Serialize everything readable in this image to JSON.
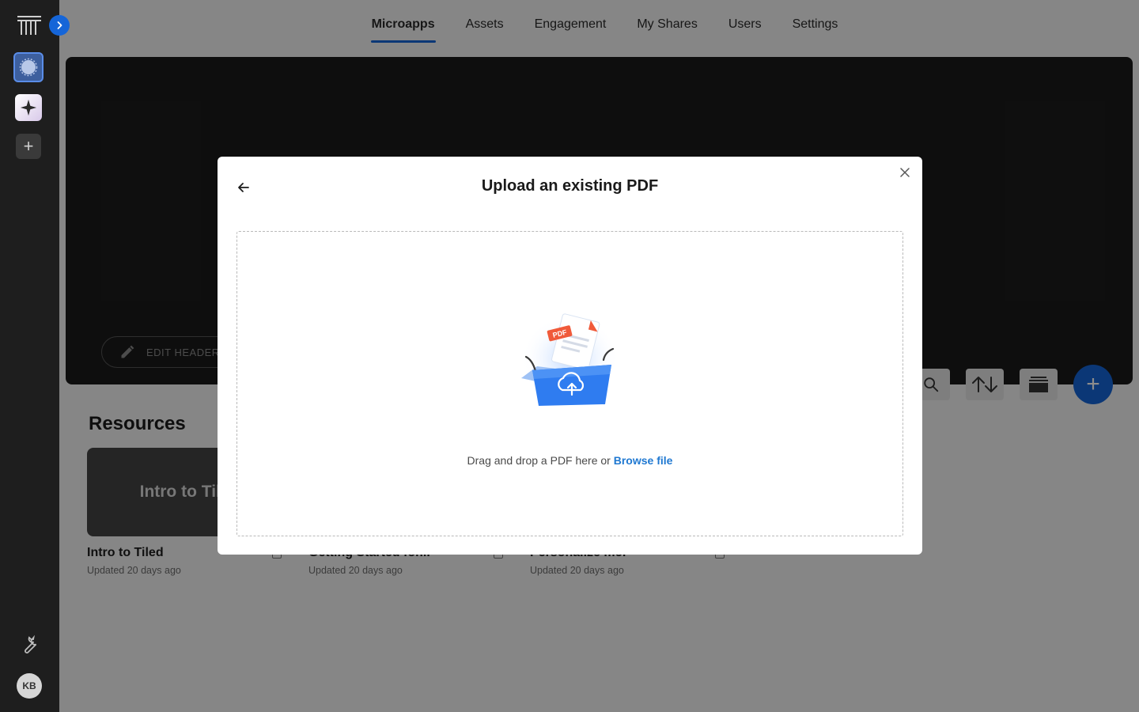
{
  "sidebar": {
    "avatar_initials": "KB"
  },
  "nav": {
    "tabs": [
      {
        "label": "Microapps",
        "active": true
      },
      {
        "label": "Assets"
      },
      {
        "label": "Engagement"
      },
      {
        "label": "My Shares"
      },
      {
        "label": "Users"
      },
      {
        "label": "Settings"
      }
    ]
  },
  "hero": {
    "edit_label": "EDIT HEADER"
  },
  "resources": {
    "title": "Resources",
    "cards": [
      {
        "thumb_text": "Intro to Tiled",
        "title": "Intro to Tiled",
        "updated": "Updated 20 days ago"
      },
      {
        "thumb_text": "",
        "title": "Getting Started for...",
        "updated": "Updated 20 days ago"
      },
      {
        "thumb_text": "",
        "title": "Personalize me!",
        "updated": "Updated 20 days ago"
      }
    ]
  },
  "modal": {
    "title": "Upload an existing PDF",
    "drop_text": "Drag and drop a PDF here or",
    "browse_label": "Browse file",
    "illustration_badge": "PDF"
  },
  "colors": {
    "accent": "#1565d8",
    "link": "#1f78d1",
    "pdf_badge": "#f05a3a"
  }
}
